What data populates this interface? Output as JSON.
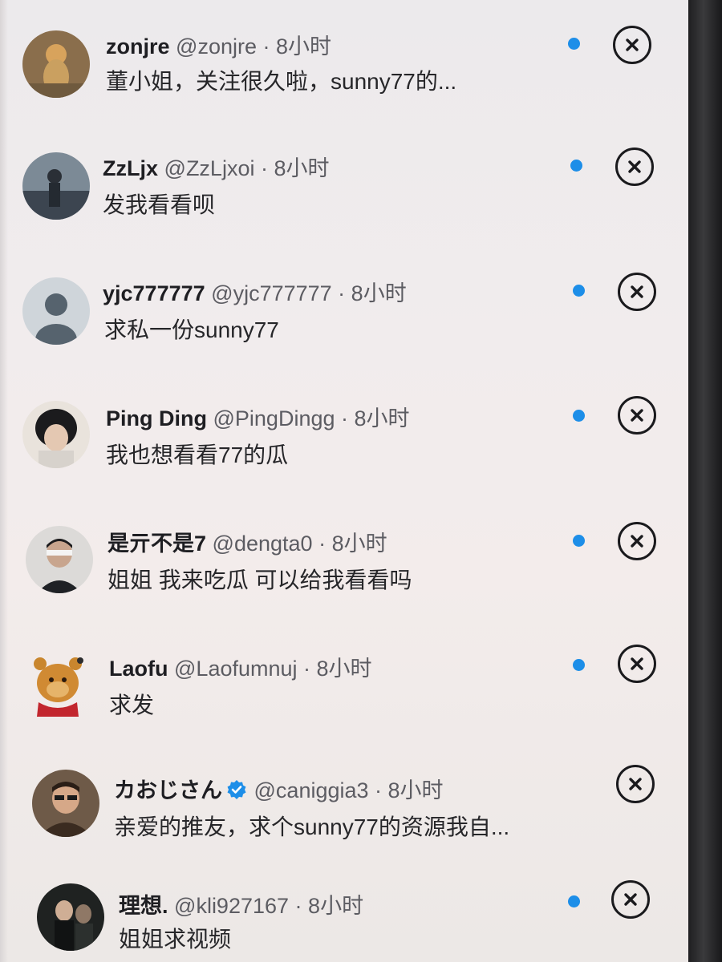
{
  "notifications": [
    {
      "name": "zonjre",
      "handle": "@zonjre",
      "sep": " · ",
      "time": "8小时",
      "text": "董小姐，关注很久啦，sunny77的..."
    },
    {
      "name": "ZzLjx",
      "handle": "@ZzLjxoi",
      "sep": " · ",
      "time": "8小时",
      "text": "发我看看呗"
    },
    {
      "name": "yjc777777",
      "handle": "@yjc777777",
      "sep": " · ",
      "time": "8小时",
      "text": "求私一份sunny77"
    },
    {
      "name": "Ping Ding",
      "handle": "@PingDingg",
      "sep": " · ",
      "time": "8小时",
      "text": "我也想看看77的瓜"
    },
    {
      "name": "是亓不是7",
      "handle": "@dengta0",
      "sep": " · ",
      "time": "8小时",
      "text": "姐姐 我来吃瓜 可以给我看看吗"
    },
    {
      "name": "Laofu",
      "handle": "@Laofumnuj",
      "sep": " · ",
      "time": "8小时",
      "text": "求发"
    },
    {
      "name": "カおじさん",
      "handle": "@caniggia3",
      "sep": " · ",
      "time": "8小时",
      "text": "亲爱的推友，求个sunny77的资源我自..."
    },
    {
      "name": "理想.",
      "handle": "@kli927167",
      "sep": " · ",
      "time": "8小时",
      "text": "姐姐求视频"
    }
  ],
  "icons": {
    "unread": "unread-dot-icon",
    "dismiss": "close-circle-icon",
    "verified": "verified-badge-icon"
  },
  "colors": {
    "accent": "#1d8ee8",
    "name_text": "#1e1e22",
    "meta_text": "#5c5c62"
  }
}
